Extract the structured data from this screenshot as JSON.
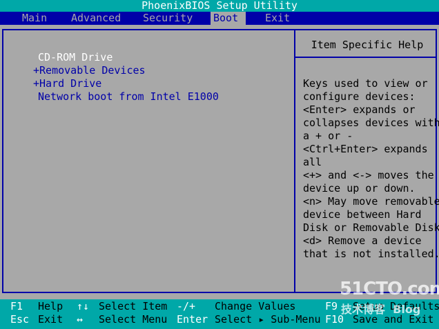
{
  "title": "PhoenixBIOS Setup Utility",
  "menu": {
    "items": [
      {
        "label": "Main"
      },
      {
        "label": "Advanced"
      },
      {
        "label": "Security"
      },
      {
        "label": "Boot"
      },
      {
        "label": "Exit"
      }
    ],
    "active": "Boot"
  },
  "boot": {
    "items": [
      {
        "label": "CD-ROM Drive",
        "selected": true
      },
      {
        "label": "+Removable Devices"
      },
      {
        "label": "+Hard Drive"
      },
      {
        "label": "Network boot from Intel E1000"
      }
    ]
  },
  "help": {
    "title": "Item Specific Help",
    "lines": [
      "Keys used to view or",
      "configure devices:",
      "<Enter> expands or",
      "collapses devices with",
      "a + or -",
      "<Ctrl+Enter> expands",
      "all",
      "<+> and <-> moves the",
      "device up or down.",
      "<n> May move removable",
      "device between Hard",
      "Disk or Removable Disk",
      "<d> Remove a device",
      "that is not installed."
    ]
  },
  "keybar": {
    "row1": {
      "f1_key": "F1",
      "f1_desc": "Help",
      "arrows_ud_key": "↑↓",
      "arrows_ud_desc": "Select Item",
      "plusminus_key": "-/+",
      "plusminus_desc": "Change Values",
      "f9_key": "F9",
      "f9_desc": "Setup Defaults"
    },
    "row2": {
      "esc_key": "Esc",
      "esc_desc": "Exit",
      "arrows_lr_key": "↔",
      "arrows_lr_desc": "Select Menu",
      "enter_key": "Enter",
      "enter_desc": "Select ▸ Sub-Menu",
      "f10_key": "F10",
      "f10_desc": "Save and Exit"
    }
  },
  "watermark": {
    "site": "51CTO.com",
    "caption": "技术博客  Blog"
  },
  "colors": {
    "background": "#a8a8a8",
    "accent_blue": "#0000a8",
    "cyan": "#00a8a8",
    "white": "#ffffff"
  }
}
